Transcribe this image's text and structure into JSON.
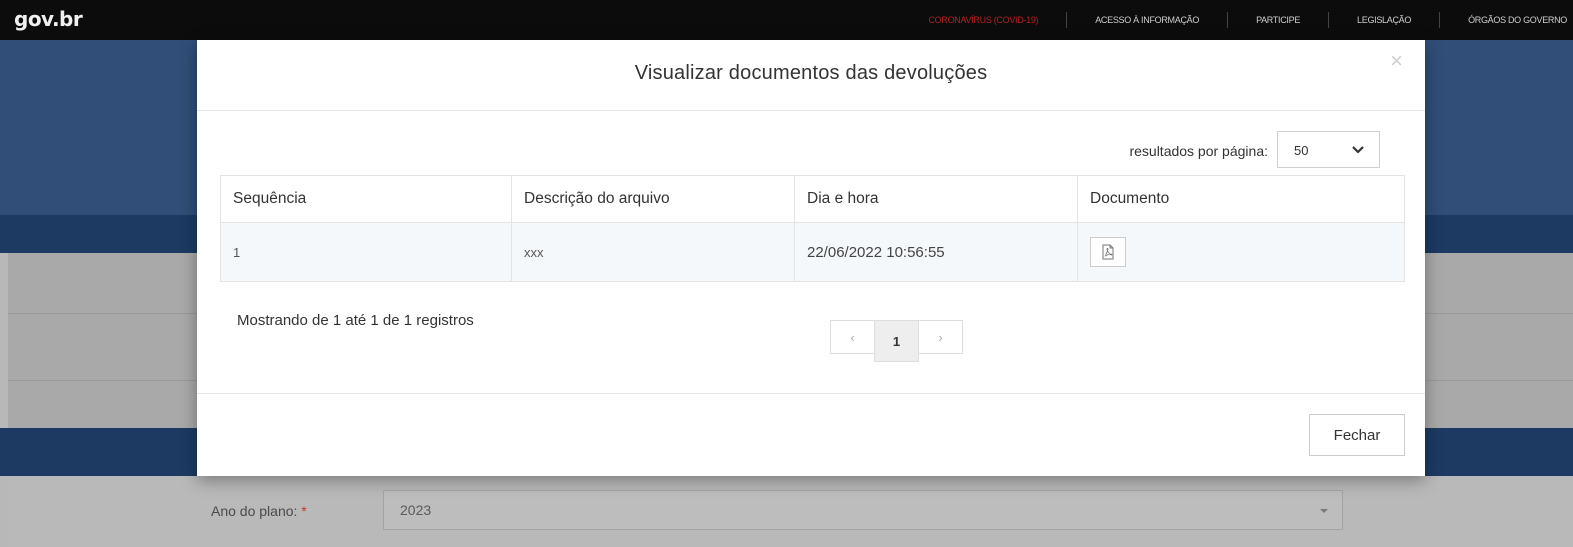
{
  "topbar": {
    "logo": "gov.br",
    "nav": [
      "CORONAVÍRUS (COVID-19)",
      "ACESSO À INFORMAÇÃO",
      "PARTICIPE",
      "LEGISLAÇÃO",
      "ÓRGÃOS DO GOVERNO"
    ]
  },
  "background_form": {
    "plan_label": "Ano do plano:",
    "required_mark": "*",
    "plan_value": "2023"
  },
  "modal": {
    "title": "Visualizar documentos das devoluções",
    "close_symbol": "×",
    "per_page_label": "resultados por página:",
    "per_page_value": "50",
    "table": {
      "headers": [
        "Sequência",
        "Descrição do arquivo",
        "Dia e hora",
        "Documento"
      ],
      "rows": [
        {
          "seq": "1",
          "desc": "xxx",
          "datetime": "22/06/2022 10:56:55",
          "doc_icon": "pdf-file-icon"
        }
      ]
    },
    "info": "Mostrando de 1 até 1 de 1 registros",
    "pagination": {
      "prev": "‹",
      "current": "1",
      "next": "›"
    },
    "footer_button": "Fechar"
  },
  "colors": {
    "topbar": "#0c0c0c",
    "hero": "#304e78",
    "stripe": "#1d3a63",
    "alert_link": "#b02020"
  }
}
